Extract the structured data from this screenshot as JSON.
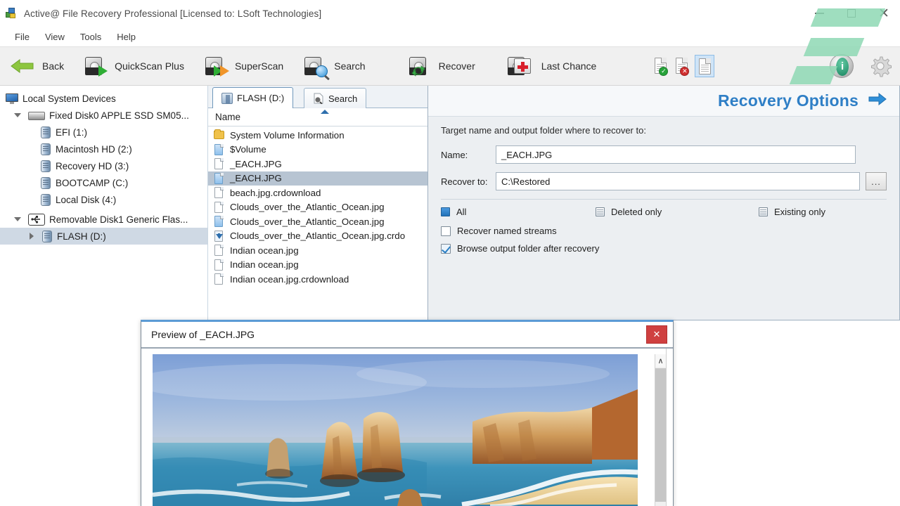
{
  "window": {
    "title": "Active@ File Recovery Professional [Licensed to: LSoft Technologies]",
    "minimize_label": "–",
    "maximize_label": "□",
    "close_label": "✕"
  },
  "menu": {
    "items": [
      "File",
      "View",
      "Tools",
      "Help"
    ]
  },
  "toolbar": {
    "items": [
      {
        "label": "Back",
        "icon": "back-arrow-icon"
      },
      {
        "label": "QuickScan Plus",
        "icon": "disk-green-arrow-icon"
      },
      {
        "label": "SuperScan",
        "icon": "disk-orange-arrow-icon"
      },
      {
        "label": "Search",
        "icon": "disk-magnifier-icon"
      },
      {
        "label": "Recover",
        "icon": "disk-recycle-icon"
      },
      {
        "label": "Last Chance",
        "icon": "disk-first-aid-icon"
      }
    ],
    "small_icons": [
      {
        "name": "document-ok-icon",
        "glyph": "✓"
      },
      {
        "name": "document-error-icon",
        "glyph": "✕"
      },
      {
        "name": "document-plain-icon",
        "glyph": ""
      }
    ],
    "right_icons": [
      {
        "name": "info-icon",
        "glyph": "i"
      },
      {
        "name": "gear-icon",
        "glyph": ""
      }
    ]
  },
  "sidebar": {
    "root_label": "Local System Devices",
    "items": [
      {
        "label": "Fixed Disk0 APPLE SSD SM05...",
        "icon": "hdd-icon",
        "level": 1,
        "expander": "down",
        "selected": false
      },
      {
        "label": "EFI (1:)",
        "icon": "drive-icon",
        "level": 2,
        "expander": "none",
        "selected": false
      },
      {
        "label": "Macintosh HD (2:)",
        "icon": "drive-icon",
        "level": 2,
        "expander": "none",
        "selected": false
      },
      {
        "label": "Recovery HD (3:)",
        "icon": "drive-icon",
        "level": 2,
        "expander": "none",
        "selected": false
      },
      {
        "label": "BOOTCAMP (C:)",
        "icon": "drive-icon",
        "level": 2,
        "expander": "none",
        "selected": false
      },
      {
        "label": "Local Disk (4:)",
        "icon": "drive-icon",
        "level": 2,
        "expander": "none",
        "selected": false
      },
      {
        "label": "Removable Disk1 Generic Flas...",
        "icon": "usb-icon",
        "level": 1,
        "expander": "down",
        "selected": false
      },
      {
        "label": "FLASH (D:)",
        "icon": "drive-icon",
        "level": 2,
        "expander": "right",
        "selected": true
      }
    ]
  },
  "filepanel": {
    "tabs": [
      {
        "label": "FLASH (D:)",
        "icon": "flash-drive-icon",
        "active": true
      },
      {
        "label": "Search",
        "icon": "search-icon",
        "active": false
      }
    ],
    "column_header": "Name",
    "rows": [
      {
        "name": "System Volume Information",
        "icon": "folder-icon",
        "selected": false
      },
      {
        "name": "$Volume",
        "icon": "file-blue-icon",
        "selected": false
      },
      {
        "name": "_EACH.JPG",
        "icon": "file-white-icon",
        "selected": false
      },
      {
        "name": "_EACH.JPG",
        "icon": "file-blue-icon",
        "selected": true
      },
      {
        "name": "beach.jpg.crdownload",
        "icon": "file-white-icon",
        "selected": false
      },
      {
        "name": "Clouds_over_the_Atlantic_Ocean.jpg",
        "icon": "file-white-icon",
        "selected": false
      },
      {
        "name": "Clouds_over_the_Atlantic_Ocean.jpg",
        "icon": "file-blue-icon",
        "selected": false
      },
      {
        "name": "Clouds_over_the_Atlantic_Ocean.jpg.crdo",
        "icon": "file-download-icon",
        "selected": false
      },
      {
        "name": "Indian ocean.jpg",
        "icon": "file-white-icon",
        "selected": false
      },
      {
        "name": "Indian ocean.jpg",
        "icon": "file-white-icon",
        "selected": false
      },
      {
        "name": "Indian ocean.jpg.crdownload",
        "icon": "file-white-icon",
        "selected": false
      }
    ]
  },
  "recovery": {
    "title": "Recovery Options",
    "next_arrow_icon": "arrow-right-icon",
    "note": "Target name and output folder where to recover to:",
    "name_label": "Name:",
    "name_value": "_EACH.JPG",
    "recover_to_label": "Recover to:",
    "recover_to_value": "C:\\Restored",
    "browse_label": "...",
    "scope_options": [
      {
        "label": "All",
        "selected": true
      },
      {
        "label": "Deleted only",
        "selected": false
      },
      {
        "label": "Existing only",
        "selected": false
      }
    ],
    "checkboxes": [
      {
        "label": "Recover named streams",
        "checked": false
      },
      {
        "label": "Browse output folder after recovery",
        "checked": true
      }
    ]
  },
  "preview": {
    "title": "Preview of _EACH.JPG",
    "close_label": "✕",
    "scroll_up_label": "∧",
    "image_alt": "coastal-cliffs-photo"
  },
  "colors": {
    "accent_blue": "#2f7fc6",
    "selection": "#b7c4d2",
    "toolbar_bg": "#f0f0f0",
    "panel_bg": "#eceff2",
    "close_red": "#cf4040",
    "watermark_green": "#8ed8b4"
  }
}
